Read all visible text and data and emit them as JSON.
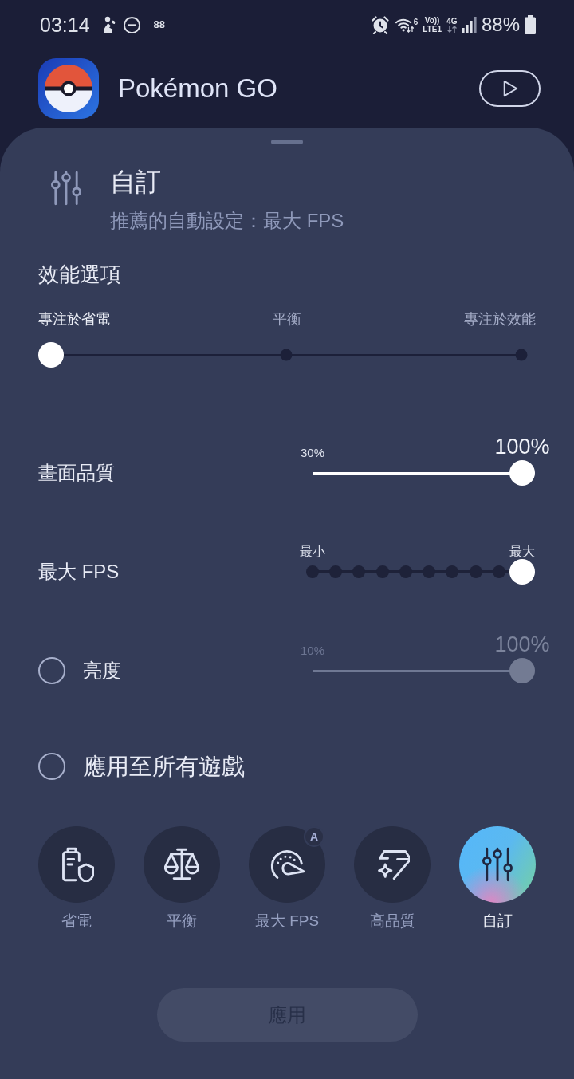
{
  "status_bar": {
    "time": "03:14",
    "notification_count": "88",
    "wifi_standard": "6",
    "volte": "Vo))",
    "lte": "LTE1",
    "network": "4G",
    "battery": "88%"
  },
  "app": {
    "name": "Pokémon GO"
  },
  "profile": {
    "title": "自訂",
    "subtitle": "推薦的自動設定：最大 FPS"
  },
  "performance": {
    "heading": "效能選項",
    "stops": [
      "專注於省電",
      "平衡",
      "專注於效能"
    ],
    "level": 0
  },
  "settings": [
    {
      "kind": "range",
      "label": "畫面品質",
      "min_label": "30%",
      "value": "100%",
      "level": 1
    },
    {
      "kind": "steps",
      "label": "最大 FPS",
      "min_label": "最小",
      "max_label": "最大",
      "level": 1
    },
    {
      "kind": "toggle",
      "label": "亮度",
      "checked": false,
      "min_label": "10%",
      "value": "100%",
      "level": 1
    }
  ],
  "apply_all": {
    "label": "應用至所有遊戲",
    "checked": false
  },
  "modes": [
    {
      "kind": "saver",
      "label": "省電",
      "selected": false
    },
    {
      "kind": "balance",
      "label": "平衡",
      "selected": false
    },
    {
      "kind": "speed",
      "label": "最大 FPS",
      "selected": false,
      "badge": "A"
    },
    {
      "kind": "quality",
      "label": "高品質",
      "selected": false
    },
    {
      "kind": "custom",
      "label": "自訂",
      "selected": true
    }
  ],
  "apply_button": {
    "label": "應用",
    "disabled": true
  }
}
